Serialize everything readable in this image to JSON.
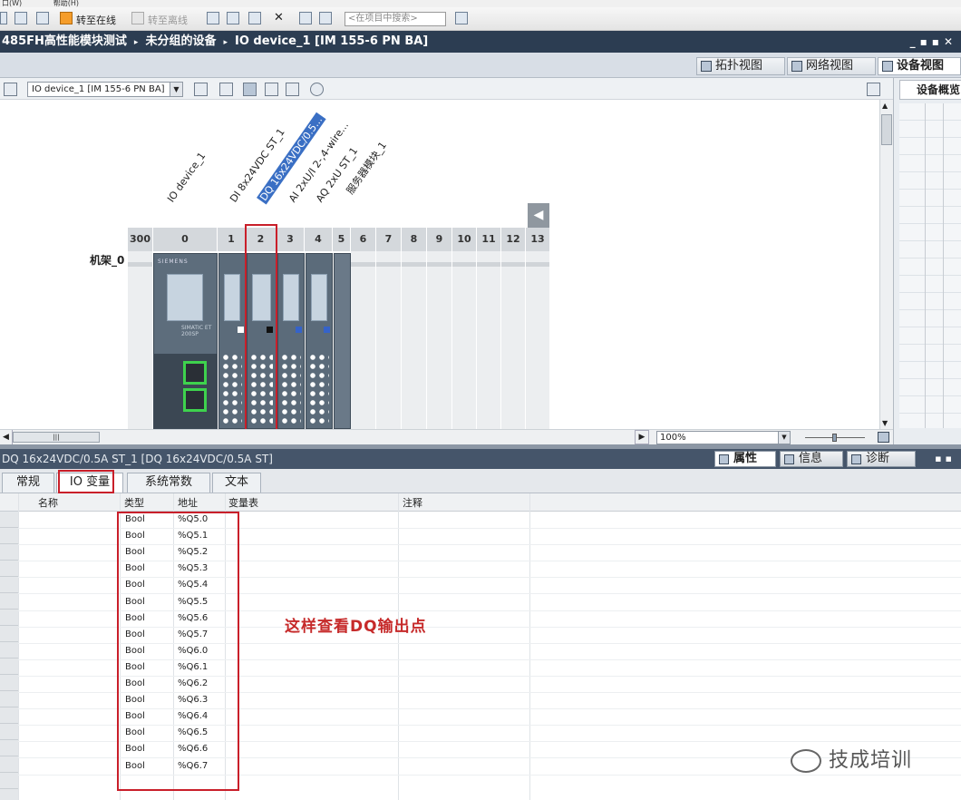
{
  "menu": {
    "items": [
      "口(W)",
      "帮助(H)"
    ]
  },
  "toolbar": {
    "go_online": "转至在线",
    "go_offline": "转至离线",
    "search_placeholder": "<在项目中搜索>"
  },
  "breadcrumb": {
    "items": [
      "485FH高性能模块测试",
      "未分组的设备",
      "IO device_1 [IM 155-6 PN BA]"
    ],
    "separator": "▸"
  },
  "view_tabs": {
    "topology": "拓扑视图",
    "network": "网络视图",
    "device": "设备视图"
  },
  "device_toolbar": {
    "device_select": "IO device_1 [IM 155-6 PN BA]"
  },
  "canvas": {
    "module_labels": [
      "IO device_1",
      "DI 8x24VDC ST_1",
      "DQ 16x24VDC/0.5...",
      "AI 2xU/I 2-,4-wire...",
      "AQ 2xU ST_1",
      "服务器模块_1"
    ],
    "rack_name": "机架_0",
    "slot_numbers": [
      "300",
      "0",
      "1",
      "2",
      "3",
      "4",
      "5",
      "6",
      "7",
      "8",
      "9",
      "10",
      "11",
      "12",
      "13"
    ],
    "brand": "SIEMENS",
    "device_text": "SIMATIC ET 200SP"
  },
  "right_panel": {
    "title": "设备概览"
  },
  "statusbar": {
    "zoom": "100%"
  },
  "properties": {
    "title": "DQ 16x24VDC/0.5A ST_1 [DQ 16x24VDC/0.5A ST]",
    "tab_properties": "属性",
    "tab_info": "信息",
    "tab_diagnostics": "诊断"
  },
  "subtabs": [
    "常规",
    "IO 变量",
    "系统常数",
    "文本"
  ],
  "io_table": {
    "columns": [
      "名称",
      "类型",
      "地址",
      "变量表",
      "注释"
    ],
    "rows": [
      {
        "type": "Bool",
        "address": "%Q5.0"
      },
      {
        "type": "Bool",
        "address": "%Q5.1"
      },
      {
        "type": "Bool",
        "address": "%Q5.2"
      },
      {
        "type": "Bool",
        "address": "%Q5.3"
      },
      {
        "type": "Bool",
        "address": "%Q5.4"
      },
      {
        "type": "Bool",
        "address": "%Q5.5"
      },
      {
        "type": "Bool",
        "address": "%Q5.6"
      },
      {
        "type": "Bool",
        "address": "%Q5.7"
      },
      {
        "type": "Bool",
        "address": "%Q6.0"
      },
      {
        "type": "Bool",
        "address": "%Q6.1"
      },
      {
        "type": "Bool",
        "address": "%Q6.2"
      },
      {
        "type": "Bool",
        "address": "%Q6.3"
      },
      {
        "type": "Bool",
        "address": "%Q6.4"
      },
      {
        "type": "Bool",
        "address": "%Q6.5"
      },
      {
        "type": "Bool",
        "address": "%Q6.6"
      },
      {
        "type": "Bool",
        "address": "%Q6.7"
      }
    ]
  },
  "annotation": "这样查看DQ输出点",
  "watermark": "技成培训",
  "colors": {
    "highlight": "#c91f2a",
    "selection": "#3a6fc4",
    "port_green": "#3ed24d"
  }
}
